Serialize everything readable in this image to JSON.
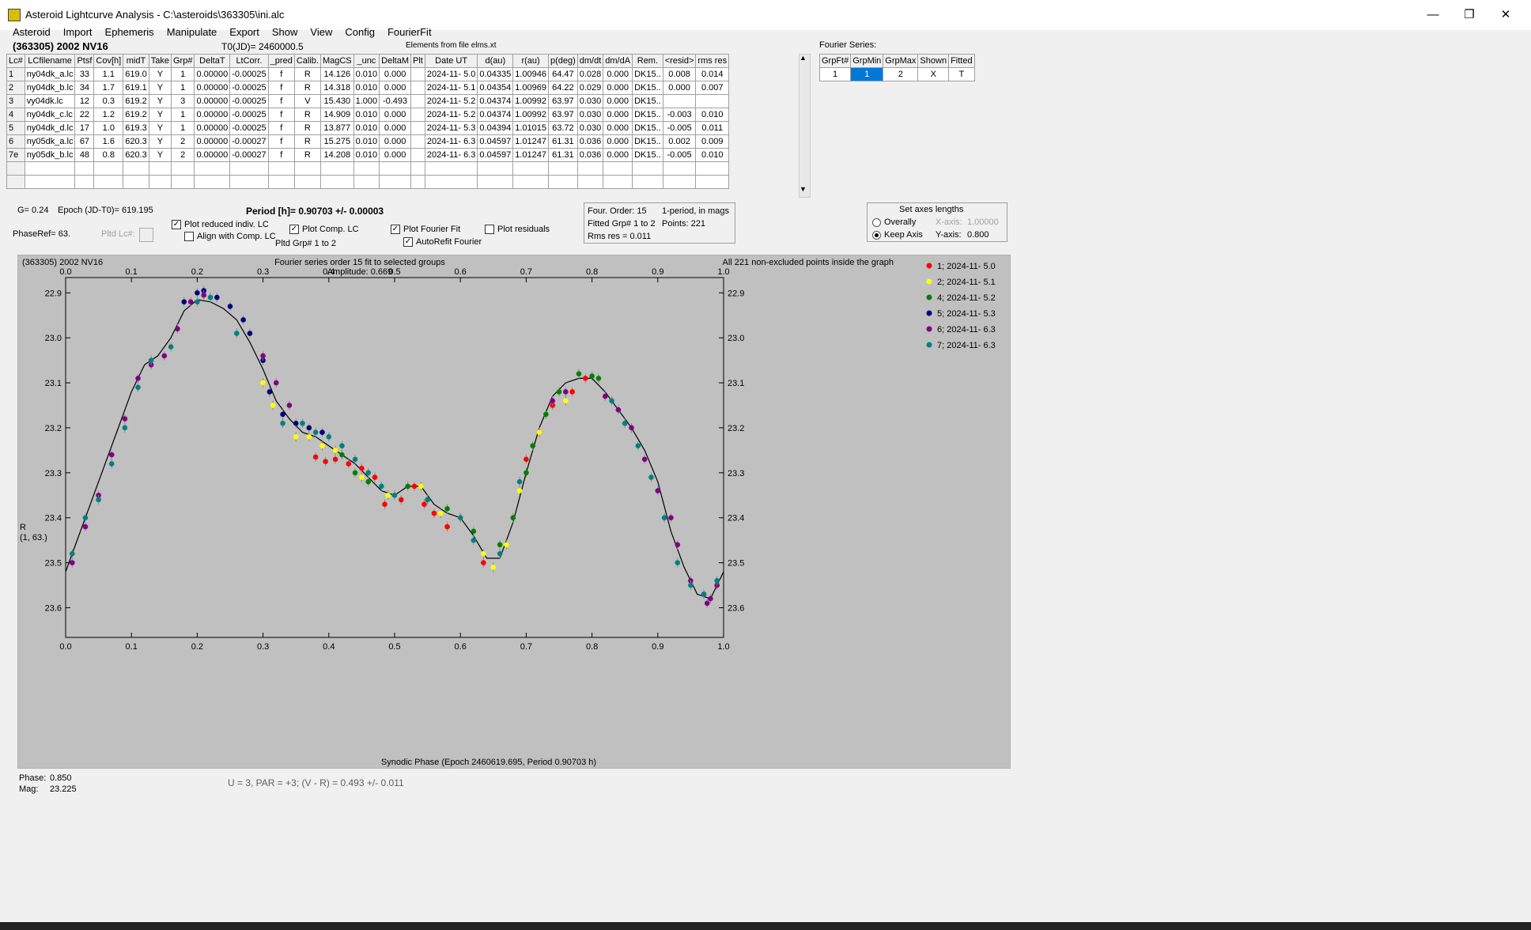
{
  "window": {
    "title": "Asteroid Lightcurve Analysis - C:\\asteroids\\363305\\ini.alc",
    "minimize": "—",
    "maximize": "❐",
    "close": "✕"
  },
  "menu": [
    "Asteroid",
    "Import",
    "Ephemeris",
    "Manipulate",
    "Export",
    "Show",
    "View",
    "Config",
    "FourierFit"
  ],
  "header": {
    "asteroid": "(363305) 2002 NV16",
    "t0": "T0(JD)= 2460000.5",
    "elements": "Elements from file elms.xt"
  },
  "lc_table": {
    "columns": [
      "Lc#",
      "LCfilename",
      "Ptsf",
      "Cov[h]",
      "midT",
      "Take",
      "Grp#",
      "DeltaT",
      "LtCorr.",
      "_pred",
      "Calib.",
      "MagCS",
      "_unc",
      "DeltaM",
      "Plt",
      "Date UT",
      "d(au)",
      "r(au)",
      "p(deg)",
      "dm/dt",
      "dm/dA",
      "Rem.",
      "<resid>",
      "rms res"
    ],
    "rows": [
      [
        "1",
        "ny04dk_a.lc",
        "33",
        "1.1",
        "619.0",
        "Y",
        "1",
        "0.00000",
        "-0.00025",
        "f",
        "R",
        "14.126",
        "0.010",
        "0.000",
        "",
        "2024-11- 5.0",
        "0.04335",
        "1.00946",
        "64.47",
        "0.028",
        "0.000",
        "DK15..",
        "0.008",
        "0.014"
      ],
      [
        "2",
        "ny04dk_b.lc",
        "34",
        "1.7",
        "619.1",
        "Y",
        "1",
        "0.00000",
        "-0.00025",
        "f",
        "R",
        "14.318",
        "0.010",
        "0.000",
        "",
        "2024-11- 5.1",
        "0.04354",
        "1.00969",
        "64.22",
        "0.029",
        "0.000",
        "DK15..",
        "0.000",
        "0.007"
      ],
      [
        "3",
        "vy04dk.lc",
        "12",
        "0.3",
        "619.2",
        "Y",
        "3",
        "0.00000",
        "-0.00025",
        "f",
        "V",
        "15.430",
        "1.000",
        "-0.493",
        "",
        "2024-11- 5.2",
        "0.04374",
        "1.00992",
        "63.97",
        "0.030",
        "0.000",
        "DK15..",
        "",
        ""
      ],
      [
        "4",
        "ny04dk_c.lc",
        "22",
        "1.2",
        "619.2",
        "Y",
        "1",
        "0.00000",
        "-0.00025",
        "f",
        "R",
        "14.909",
        "0.010",
        "0.000",
        "",
        "2024-11- 5.2",
        "0.04374",
        "1.00992",
        "63.97",
        "0.030",
        "0.000",
        "DK15..",
        "-0.003",
        "0.010"
      ],
      [
        "5",
        "ny04dk_d.lc",
        "17",
        "1.0",
        "619.3",
        "Y",
        "1",
        "0.00000",
        "-0.00025",
        "f",
        "R",
        "13.877",
        "0.010",
        "0.000",
        "",
        "2024-11- 5.3",
        "0.04394",
        "1.01015",
        "63.72",
        "0.030",
        "0.000",
        "DK15..",
        "-0.005",
        "0.011"
      ],
      [
        "6",
        "ny05dk_a.lc",
        "67",
        "1.6",
        "620.3",
        "Y",
        "2",
        "0.00000",
        "-0.00027",
        "f",
        "R",
        "15.275",
        "0.010",
        "0.000",
        "",
        "2024-11- 6.3",
        "0.04597",
        "1.01247",
        "61.31",
        "0.036",
        "0.000",
        "DK15..",
        "0.002",
        "0.009"
      ],
      [
        "7e",
        "ny05dk_b.lc",
        "48",
        "0.8",
        "620.3",
        "Y",
        "2",
        "0.00000",
        "-0.00027",
        "f",
        "R",
        "14.208",
        "0.010",
        "0.000",
        "",
        "2024-11- 6.3",
        "0.04597",
        "1.01247",
        "61.31",
        "0.036",
        "0.000",
        "DK15..",
        "-0.005",
        "0.010"
      ]
    ]
  },
  "fourier_series": {
    "label": "Fourier Series:",
    "columns": [
      "GrpFt#",
      "GrpMin",
      "GrpMax",
      "Shown",
      "Fitted"
    ],
    "row": [
      "1",
      "1",
      "2",
      "X",
      "T"
    ]
  },
  "controls": {
    "g": "G= 0.24",
    "epoch": "Epoch (JD-T0)= 619.195",
    "period": "Period [h]= 0.90703 +/- 0.00003",
    "phaseref": "PhaseRef= 63.",
    "pltd_lc": "Pltd Lc#:",
    "plot_reduced": "Plot reduced indiv. LC",
    "align_comp": "Align with Comp. LC",
    "plot_comp": "Plot Comp. LC",
    "pltd_grp": "Pltd Grp#  1   to   2",
    "plot_fourier": "Plot Fourier Fit",
    "autorefit": "AutoRefit Fourier",
    "plot_resid": "Plot residuals",
    "four_order": "Four. Order: 15",
    "one_period": "1-period, in mags",
    "fitted_grp": "Fitted Grp# 1 to 2",
    "points": "Points: 221",
    "rms": "Rms res      = 0.011",
    "axes_title": "Set axes lengths",
    "overally": "Overally",
    "keep_axis": "Keep Axis",
    "x_axis_label": "X-axis:",
    "x_axis_val": "1.00000",
    "y_axis_label": "Y-axis:",
    "y_axis_val": "0.800"
  },
  "chart_data": {
    "type": "scatter",
    "title": "Fourier series order 15 fit to selected groups",
    "subtitle": "Amplitude: 0.669",
    "corner_label": "(363305) 2002 NV16",
    "note": "All 221 non-excluded points inside the graph",
    "xlabel": "Synodic Phase (Epoch 2460619.695, Period 0.90703 h)",
    "ylabel": "R",
    "ylabel2": "(1, 63.)",
    "xlim": [
      0.0,
      1.0
    ],
    "ylim": [
      23.534,
      22.866
    ],
    "x_ticks": [
      "0.0",
      "0.1",
      "0.2",
      "0.3",
      "0.4",
      "0.5",
      "0.6",
      "0.7",
      "0.8",
      "0.9",
      "1.0"
    ],
    "y_ticks": [
      "22.9",
      "23.0",
      "23.1",
      "23.2",
      "23.3",
      "23.4",
      "23.5",
      "23.6"
    ],
    "y_tick_values": [
      22.9,
      23.0,
      23.1,
      23.2,
      23.3,
      23.4,
      23.5,
      23.6
    ],
    "y_range": [
      22.866,
      23.666
    ],
    "grid": false,
    "legend_position": "right",
    "fit_curve": {
      "x": [
        0.0,
        0.02,
        0.04,
        0.06,
        0.08,
        0.1,
        0.12,
        0.14,
        0.16,
        0.18,
        0.2,
        0.22,
        0.24,
        0.26,
        0.28,
        0.3,
        0.32,
        0.34,
        0.36,
        0.38,
        0.4,
        0.42,
        0.44,
        0.46,
        0.48,
        0.5,
        0.52,
        0.54,
        0.56,
        0.58,
        0.6,
        0.62,
        0.64,
        0.66,
        0.68,
        0.7,
        0.72,
        0.74,
        0.76,
        0.78,
        0.8,
        0.82,
        0.84,
        0.86,
        0.88,
        0.9,
        0.92,
        0.94,
        0.96,
        0.98,
        1.0
      ],
      "y": [
        23.52,
        23.44,
        23.36,
        23.28,
        23.2,
        23.12,
        23.06,
        23.04,
        23.0,
        22.94,
        22.915,
        22.92,
        22.935,
        22.96,
        23.01,
        23.07,
        23.14,
        23.18,
        23.21,
        23.22,
        23.24,
        23.26,
        23.28,
        23.31,
        23.34,
        23.35,
        23.33,
        23.33,
        23.37,
        23.39,
        23.4,
        23.44,
        23.49,
        23.49,
        23.41,
        23.3,
        23.2,
        23.13,
        23.1,
        23.09,
        23.09,
        23.12,
        23.16,
        23.2,
        23.25,
        23.32,
        23.43,
        23.51,
        23.57,
        23.58,
        23.52
      ]
    },
    "series": [
      {
        "name": "1; 2024-11- 5.0",
        "color": "#ff0000",
        "x": [
          0.38,
          0.395,
          0.41,
          0.43,
          0.45,
          0.47,
          0.485,
          0.51,
          0.53,
          0.545,
          0.56,
          0.58,
          0.635,
          0.7,
          0.72,
          0.74,
          0.77,
          0.79
        ],
        "y": [
          23.265,
          23.275,
          23.27,
          23.28,
          23.29,
          23.31,
          23.37,
          23.36,
          23.33,
          23.37,
          23.39,
          23.42,
          23.5,
          23.27,
          23.21,
          23.15,
          23.12,
          23.09
        ]
      },
      {
        "name": "2; 2024-11- 5.1",
        "color": "#ffff00",
        "x": [
          0.3,
          0.315,
          0.35,
          0.37,
          0.39,
          0.41,
          0.45,
          0.49,
          0.54,
          0.57,
          0.6,
          0.635,
          0.65,
          0.67,
          0.69,
          0.72,
          0.76
        ],
        "y": [
          23.1,
          23.15,
          23.22,
          23.22,
          23.24,
          23.25,
          23.31,
          23.35,
          23.33,
          23.39,
          23.4,
          23.48,
          23.51,
          23.46,
          23.34,
          23.21,
          23.14
        ]
      },
      {
        "name": "4; 2024-11- 5.2",
        "color": "#008000",
        "x": [
          0.42,
          0.44,
          0.46,
          0.52,
          0.55,
          0.58,
          0.62,
          0.66,
          0.68,
          0.7,
          0.71,
          0.73,
          0.75,
          0.78,
          0.8,
          0.81
        ],
        "y": [
          23.26,
          23.3,
          23.32,
          23.33,
          23.36,
          23.38,
          23.43,
          23.46,
          23.4,
          23.3,
          23.24,
          23.17,
          23.12,
          23.08,
          23.085,
          23.09
        ]
      },
      {
        "name": "5; 2024-11- 5.3",
        "color": "#000080",
        "x": [
          0.18,
          0.2,
          0.21,
          0.23,
          0.25,
          0.27,
          0.28,
          0.3,
          0.31,
          0.33,
          0.35,
          0.37,
          0.39
        ],
        "y": [
          22.92,
          22.9,
          22.895,
          22.91,
          22.93,
          22.96,
          22.99,
          23.05,
          23.12,
          23.17,
          23.19,
          23.2,
          23.21
        ]
      },
      {
        "name": "6; 2024-11- 6.3",
        "color": "#800080",
        "x": [
          0.01,
          0.03,
          0.05,
          0.07,
          0.09,
          0.11,
          0.13,
          0.15,
          0.17,
          0.19,
          0.21,
          0.3,
          0.32,
          0.34,
          0.74,
          0.76,
          0.82,
          0.84,
          0.86,
          0.88,
          0.9,
          0.92,
          0.93,
          0.95,
          0.97,
          0.975,
          0.98,
          0.99
        ],
        "y": [
          23.5,
          23.42,
          23.35,
          23.26,
          23.18,
          23.09,
          23.06,
          23.04,
          22.98,
          22.92,
          22.905,
          23.04,
          23.1,
          23.15,
          23.14,
          23.12,
          23.13,
          23.16,
          23.2,
          23.27,
          23.34,
          23.4,
          23.46,
          23.54,
          23.57,
          23.59,
          23.58,
          23.55
        ]
      },
      {
        "name": "7; 2024-11- 6.3",
        "color": "#008080",
        "x": [
          0.01,
          0.03,
          0.05,
          0.07,
          0.09,
          0.11,
          0.13,
          0.16,
          0.2,
          0.22,
          0.26,
          0.33,
          0.36,
          0.38,
          0.4,
          0.42,
          0.44,
          0.46,
          0.48,
          0.5,
          0.55,
          0.6,
          0.62,
          0.66,
          0.69,
          0.83,
          0.85,
          0.87,
          0.89,
          0.91,
          0.93,
          0.95,
          0.97,
          0.99
        ],
        "y": [
          23.48,
          23.4,
          23.36,
          23.28,
          23.2,
          23.11,
          23.05,
          23.02,
          22.92,
          22.91,
          22.99,
          23.19,
          23.19,
          23.21,
          23.22,
          23.24,
          23.27,
          23.3,
          23.33,
          23.35,
          23.36,
          23.4,
          23.45,
          23.48,
          23.32,
          23.14,
          23.19,
          23.24,
          23.31,
          23.4,
          23.5,
          23.55,
          23.57,
          23.54
        ]
      }
    ]
  },
  "status": {
    "phase_label": "Phase:",
    "phase_val": "0.850",
    "mag_label": "Mag:",
    "mag_val": "23.225",
    "color_index": "U = 3, PAR = +3; (V - R) = 0.493 +/- 0.011"
  }
}
